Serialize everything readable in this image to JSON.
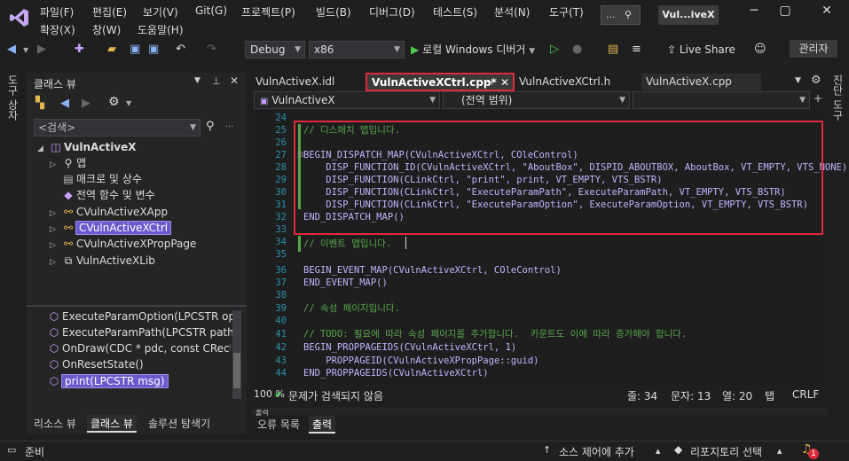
{
  "menu": {
    "items": [
      "파일(F)",
      "편집(E)",
      "보기(V)",
      "Git(G)",
      "프로젝트(P)",
      "빌드(B)",
      "디버그(D)",
      "테스트(S)",
      "분석(N)",
      "도구(T)"
    ],
    "items2": [
      "확장(X)",
      "창(W)",
      "도움말(H)"
    ],
    "search": "...",
    "title": "Vul...iveX"
  },
  "toolbar": {
    "config": "Debug",
    "platform": "x86",
    "run_label": "로컬 Windows 디버거",
    "live_share": "Live Share",
    "admin": "관리자"
  },
  "side": {
    "left": "도구 상자",
    "right": "진단 도구"
  },
  "class_view": {
    "title": "클래스 뷰",
    "search_placeholder": "<검색>",
    "project": "VulnActiveX",
    "nodes": [
      "맵",
      "매크로 및 상수",
      "전역 함수 및 변수",
      "CVulnActiveXApp",
      "CVulnActiveXCtrl",
      "CVulnActiveXPropPage",
      "VulnActiveXLib"
    ],
    "members": [
      "ExecuteParamOption(LPCSTR op)",
      "ExecuteParamPath(LPCSTR path)",
      "OnDraw(CDC * pdc, const CRect &",
      "OnResetState()",
      "print(LPCSTR msg)"
    ],
    "bottom_tabs": [
      "리소스 뷰",
      "클래스 뷰",
      "솔루션 탐색기"
    ]
  },
  "editor": {
    "tabs": [
      "VulnActiveX.idl",
      "VulnActiveXCtrl.cpp*",
      "VulnActiveXCtrl.h",
      "VulnActiveX.cpp"
    ],
    "nav_project": "VulnActiveX",
    "nav_scope": "(전역 범위)",
    "lines": [
      {
        "n": "24",
        "t": ""
      },
      {
        "n": "25",
        "t": "// 디스패치 맵입니다."
      },
      {
        "n": "26",
        "t": ""
      },
      {
        "n": "27",
        "t": "BEGIN_DISPATCH_MAP(CVulnActiveXCtrl, COleControl)"
      },
      {
        "n": "28",
        "t": "    DISP_FUNCTION_ID(CVulnActiveXCtrl, \"AboutBox\", DISPID_ABOUTBOX, AboutBox, VT_EMPTY, VTS_NONE)"
      },
      {
        "n": "29",
        "t": "    DISP_FUNCTION(CLinkCtrl, \"print\", print, VT_EMPTY, VTS_BSTR)"
      },
      {
        "n": "30",
        "t": "    DISP_FUNCTION(CLinkCtrl, \"ExecuteParamPath\", ExecuteParamPath, VT_EMPTY, VTS_BSTR)"
      },
      {
        "n": "31",
        "t": "    DISP_FUNCTION(CLinkCtrl, \"ExecuteParamOption\", ExecuteParamOption, VT_EMPTY, VTS_BSTR)"
      },
      {
        "n": "32",
        "t": "END_DISPATCH_MAP()"
      },
      {
        "n": "33",
        "t": ""
      },
      {
        "n": "34",
        "t": "// 이벤트 맵입니다."
      },
      {
        "n": "35",
        "t": ""
      },
      {
        "n": "36",
        "t": "BEGIN_EVENT_MAP(CVulnActiveXCtrl, COleControl)"
      },
      {
        "n": "37",
        "t": "END_EVENT_MAP()"
      },
      {
        "n": "38",
        "t": ""
      },
      {
        "n": "39",
        "t": "// 속성 페이지입니다."
      },
      {
        "n": "40",
        "t": ""
      },
      {
        "n": "41",
        "t": "// TODO: 필요에 따라 속성 페이지를 추가합니다.  카운트도 이에 따라 증가해야 합니다."
      },
      {
        "n": "42",
        "t": "BEGIN_PROPPAGEIDS(CVulnActiveXCtrl, 1)"
      },
      {
        "n": "43",
        "t": "    PROPPAGEID(CVulnActiveXPropPage::guid)"
      },
      {
        "n": "44",
        "t": "END_PROPPAGEIDS(CVulnActiveXCtrl)"
      }
    ],
    "zoom": "100 %",
    "issues": "문제가 검색되지 않음",
    "line": "줄: 34",
    "char": "문자: 13",
    "col": "열: 20",
    "tab": "탭",
    "eol": "CRLF"
  },
  "output": {
    "header": "출력",
    "tabs": [
      "오류 목록",
      "출력"
    ]
  },
  "status": {
    "ready": "준비",
    "source_control": "소스 제어에 추가",
    "repo": "리포지토리 선택",
    "notifications": "1"
  },
  "colors": {
    "accent_red": "#e0293a",
    "selection": "#6a5acd",
    "comment": "#57a64a",
    "macro": "#beb7ff",
    "string": "#d69d85"
  }
}
